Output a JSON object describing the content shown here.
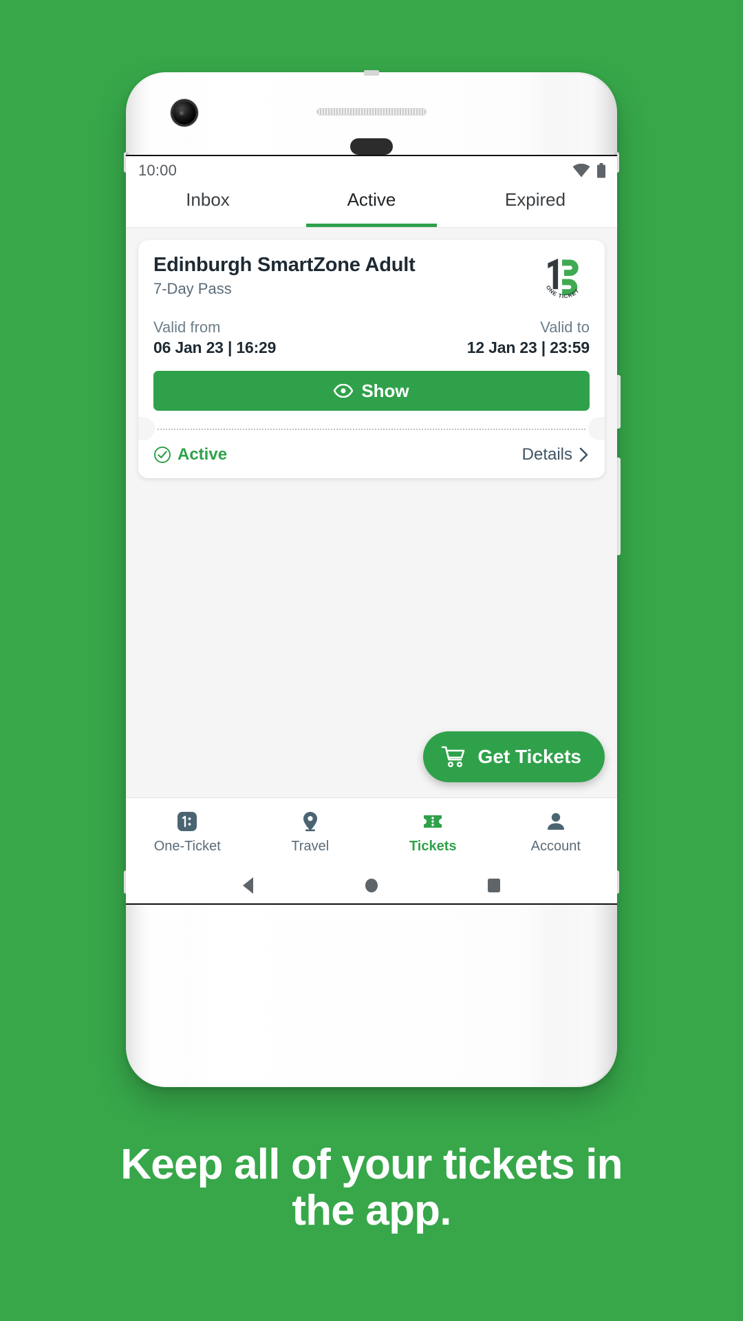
{
  "theme": {
    "background_green": "#37a74a",
    "accent_green": "#2fa14a",
    "dark_text": "#1e2a33",
    "muted_text": "#5a6b78"
  },
  "phone": {
    "icons": {
      "camera": "front-camera",
      "speaker": "earpiece-speaker",
      "sensor": "proximity-sensor"
    }
  },
  "statusbar": {
    "time": "10:00",
    "wifi_icon": "wifi-icon",
    "battery_icon": "battery-icon"
  },
  "tabs": [
    {
      "label": "Inbox",
      "active": false
    },
    {
      "label": "Active",
      "active": true
    },
    {
      "label": "Expired",
      "active": false
    }
  ],
  "ticket": {
    "title": "Edinburgh SmartZone Adult",
    "subtitle": "7-Day Pass",
    "brand_logo": "one-ticket-logo",
    "brand_logo_text": "ONE TICKET",
    "valid_from_label": "Valid from",
    "valid_from_value": "06 Jan 23 | 16:29",
    "valid_to_label": "Valid to",
    "valid_to_value": "12 Jan 23 | 23:59",
    "show_button_label": "Show",
    "show_button_icon": "eye-icon",
    "status_label": "Active",
    "status_icon": "check-circle-icon",
    "details_label": "Details",
    "details_icon": "chevron-right-icon"
  },
  "fab": {
    "label": "Get Tickets",
    "icon": "shopping-cart-icon"
  },
  "bottom_nav": [
    {
      "label": "One-Ticket",
      "icon": "one-ticket-icon",
      "active": false
    },
    {
      "label": "Travel",
      "icon": "map-pin-icon",
      "active": false
    },
    {
      "label": "Tickets",
      "icon": "ticket-icon",
      "active": true
    },
    {
      "label": "Account",
      "icon": "person-icon",
      "active": false
    }
  ],
  "system_nav": [
    {
      "icon": "back-triangle-icon"
    },
    {
      "icon": "home-circle-icon"
    },
    {
      "icon": "recents-square-icon"
    }
  ],
  "caption": {
    "line1": "Keep all of your tickets in",
    "line2": "the app."
  }
}
